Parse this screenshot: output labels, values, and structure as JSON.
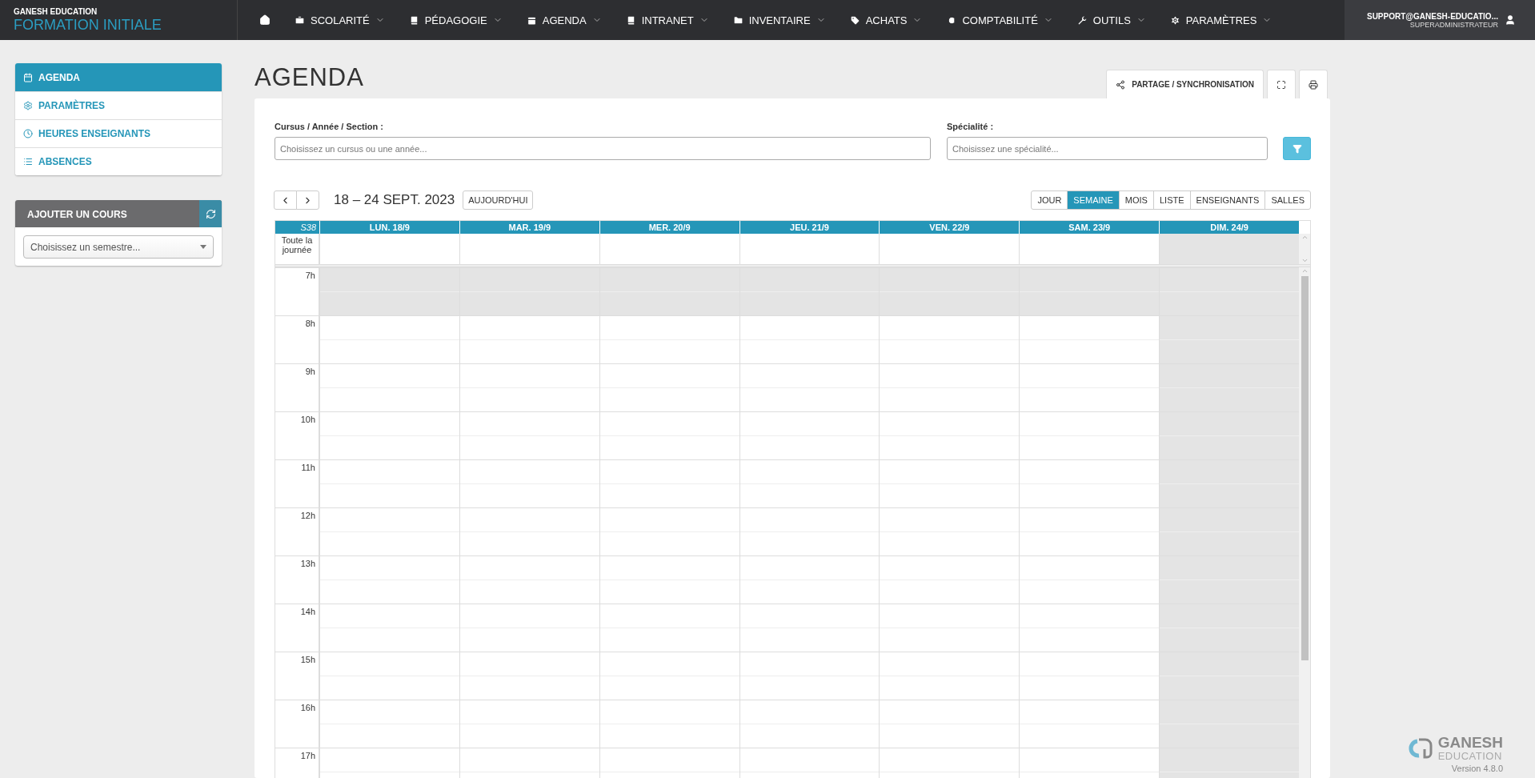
{
  "brand": {
    "org": "GANESH EDUCATION",
    "app": "FORMATION INITIALE"
  },
  "nav": [
    {
      "label": "SCOLARITÉ"
    },
    {
      "label": "PÉDAGOGIE"
    },
    {
      "label": "AGENDA"
    },
    {
      "label": "INTRANET"
    },
    {
      "label": "INVENTAIRE"
    },
    {
      "label": "ACHATS"
    },
    {
      "label": "COMPTABILITÉ"
    },
    {
      "label": "OUTILS"
    },
    {
      "label": "PARAMÈTRES"
    }
  ],
  "user": {
    "email": "SUPPORT@GANESH-EDUCATIO...",
    "role": "SUPERADMINISTRATEUR"
  },
  "sidebar": {
    "items": [
      {
        "label": "AGENDA",
        "selected": true
      },
      {
        "label": "PARAMÈTRES",
        "selected": false
      },
      {
        "label": "HEURES ENSEIGNANTS",
        "selected": false
      },
      {
        "label": "ABSENCES",
        "selected": false
      }
    ]
  },
  "add_course": {
    "title": "AJOUTER UN COURS",
    "placeholder": "Choisissez un semestre..."
  },
  "page_title": "AGENDA",
  "share_button": "PARTAGE / SYNCHRONISATION",
  "filters": [
    {
      "label": "Cursus / Année / Section :",
      "placeholder": "Choisissez un cursus ou une année..."
    },
    {
      "label": "Spécialité :",
      "placeholder": "Choisissez une spécialité..."
    }
  ],
  "calendar": {
    "range": "18 – 24 SEPT. 2023",
    "today_button": "AUJOURD'HUI",
    "views": [
      {
        "label": "JOUR",
        "selected": false
      },
      {
        "label": "SEMAINE",
        "selected": true
      },
      {
        "label": "MOIS",
        "selected": false
      },
      {
        "label": "LISTE",
        "selected": false
      },
      {
        "label": "ENSEIGNANTS",
        "selected": false
      },
      {
        "label": "SALLES",
        "selected": false
      }
    ],
    "week": "S38",
    "all_day": "Toute la journée",
    "days": [
      {
        "label": "LUN. 18/9",
        "shaded": false
      },
      {
        "label": "MAR. 19/9",
        "shaded": false
      },
      {
        "label": "MER. 20/9",
        "shaded": false
      },
      {
        "label": "JEU. 21/9",
        "shaded": false
      },
      {
        "label": "VEN. 22/9",
        "shaded": false
      },
      {
        "label": "SAM. 23/9",
        "shaded": false
      },
      {
        "label": "DIM. 24/9",
        "shaded": true
      }
    ],
    "hours": [
      {
        "label": "7h",
        "shaded": true
      },
      {
        "label": "8h",
        "shaded": false
      },
      {
        "label": "9h",
        "shaded": false
      },
      {
        "label": "10h",
        "shaded": false
      },
      {
        "label": "11h",
        "shaded": false
      },
      {
        "label": "12h",
        "shaded": false
      },
      {
        "label": "13h",
        "shaded": false
      },
      {
        "label": "14h",
        "shaded": false
      },
      {
        "label": "15h",
        "shaded": false
      },
      {
        "label": "16h",
        "shaded": false
      },
      {
        "label": "17h",
        "shaded": false
      }
    ]
  },
  "footer": {
    "name": "GANESH",
    "sub": "EDUCATION",
    "version": "Version 4.8.0"
  }
}
